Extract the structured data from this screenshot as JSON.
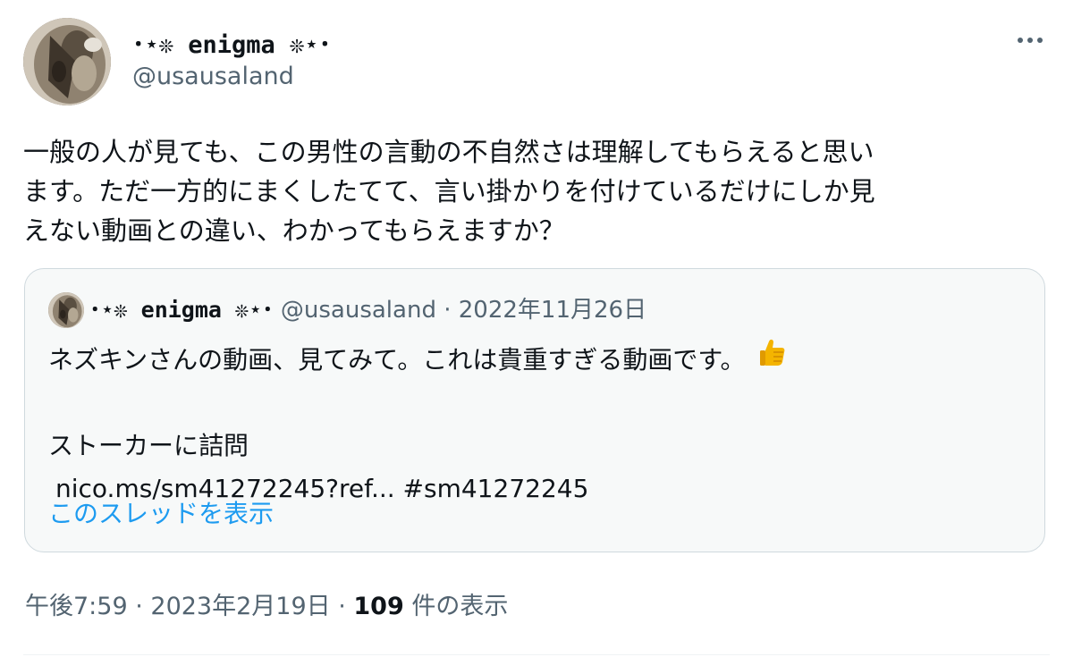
{
  "tweet": {
    "display_name": "･⋆❊ enigma ❊⋆･",
    "handle": "@usausaland",
    "text_lines": [
      "一般の人が見ても、この男性の言動の不自然さは理解してもらえると思い",
      "ます。ただ一方的にまくしたてて、言い掛かりを付けているだけにしか見",
      "えない動画との違い、わかってもらえますか？"
    ],
    "time": "午後7:59",
    "date": "2023年2月19日",
    "views_count": "109",
    "views_label": "件の表示",
    "separator": " · "
  },
  "quote": {
    "display_name": "･⋆❊ enigma ❊⋆･",
    "handle": "@usausaland",
    "date": "2022年11月26日",
    "separator": " · ",
    "line1": "ネズキンさんの動画、見てみて。これは貴重すぎる動画です。",
    "line2": "ストーカーに詰問",
    "link": "nico.ms/sm41272245?ref...",
    "hashtag": "#sm41272245",
    "show_thread": "このスレッドを表示"
  },
  "icons": {
    "more": "more-icon",
    "thumbs_up": "thumbs-up-emoji"
  },
  "colors": {
    "text": "#0f1419",
    "secondary": "#536471",
    "link": "#1d9bf0",
    "border": "#cfd9de",
    "quote_bg": "#f7f9f9"
  }
}
